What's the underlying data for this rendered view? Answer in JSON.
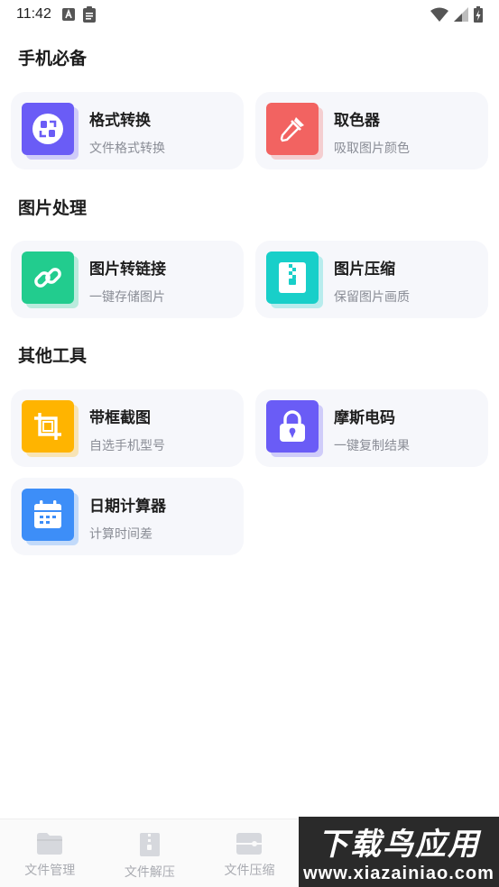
{
  "status_bar": {
    "time": "11:42"
  },
  "sections": [
    {
      "title": "手机必备",
      "items": [
        {
          "title": "格式转换",
          "subtitle": "文件格式转换",
          "icon": "format-convert-icon",
          "color": "#6a5cf6"
        },
        {
          "title": "取色器",
          "subtitle": "吸取图片颜色",
          "icon": "color-picker-icon",
          "color": "#f26361"
        }
      ]
    },
    {
      "title": "图片处理",
      "items": [
        {
          "title": "图片转链接",
          "subtitle": "一键存储图片",
          "icon": "link-icon",
          "color": "#22cc8e"
        },
        {
          "title": "图片压缩",
          "subtitle": "保留图片画质",
          "icon": "zip-icon",
          "color": "#18cfc9"
        }
      ]
    },
    {
      "title": "其他工具",
      "items": [
        {
          "title": "带框截图",
          "subtitle": "自选手机型号",
          "icon": "crop-icon",
          "color": "#ffb400"
        },
        {
          "title": "摩斯电码",
          "subtitle": "一键复制结果",
          "icon": "lock-icon",
          "color": "#6a5cf6"
        },
        {
          "title": "日期计算器",
          "subtitle": "计算时间差",
          "icon": "calendar-icon",
          "color": "#3d8ef8"
        }
      ]
    }
  ],
  "bottom_nav": [
    {
      "label": "文件管理",
      "icon": "folder-icon"
    },
    {
      "label": "文件解压",
      "icon": "unzip-icon"
    },
    {
      "label": "文件压缩",
      "icon": "compress-icon"
    }
  ],
  "watermark": {
    "big": "下载鸟应用",
    "small": "www.xiazainiao.com"
  }
}
